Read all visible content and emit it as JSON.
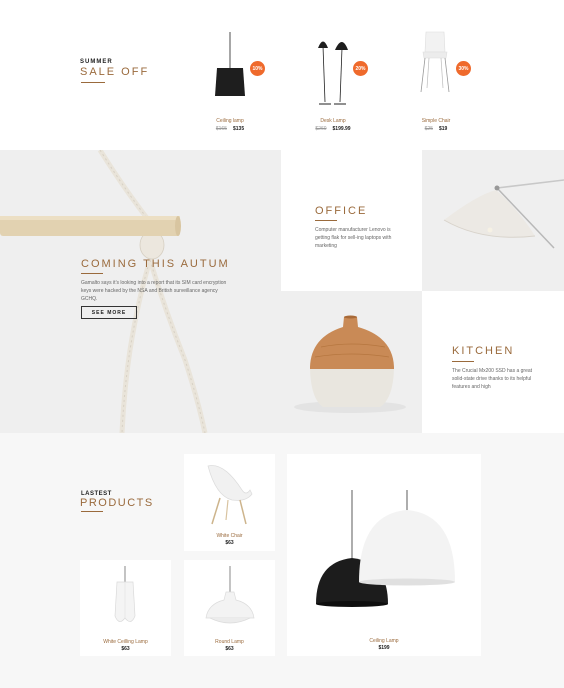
{
  "sale": {
    "eyebrow": "SUMMER",
    "title": "SALE OFF",
    "products": [
      {
        "name": "Ceiling lamp",
        "old_price": "$165",
        "price": "$135",
        "badge": "10%"
      },
      {
        "name": "Desk Lamp",
        "old_price": "$260",
        "price": "$199.99",
        "badge": "20%"
      },
      {
        "name": "Simple Chair",
        "old_price": "$25",
        "price": "$19",
        "badge": "30%"
      }
    ]
  },
  "coming": {
    "title": "COMING THIS AUTUM",
    "text": "Gamalto says it’s looking into a report that its SIM card encryption keys were hacked by the NSA and British surveillance agency GCHQ.",
    "button": "SEE MORE"
  },
  "office": {
    "title": "OFFICE",
    "text": "Computer manufacturer Lenovo is getting flak for sell-ing laptops with marketing"
  },
  "kitchen": {
    "title": "KITCHEN",
    "text": "The Crucial Mx200 SSD has a great solid-state drive thanks to its helpful features and high"
  },
  "latest": {
    "eyebrow": "LASTEST",
    "title": "PRODUCTS",
    "items": [
      {
        "name": "White Chair",
        "price": "$63"
      },
      {
        "name": "White Ceilling Lamp",
        "price": "$63"
      },
      {
        "name": "Round Lamp",
        "price": "$63"
      },
      {
        "name": "Ceiling Lamp",
        "price": "$199"
      }
    ]
  },
  "colors": {
    "accent": "#9a6a3c",
    "badge": "#ef6a2c",
    "tile_gray": "#efefef"
  }
}
